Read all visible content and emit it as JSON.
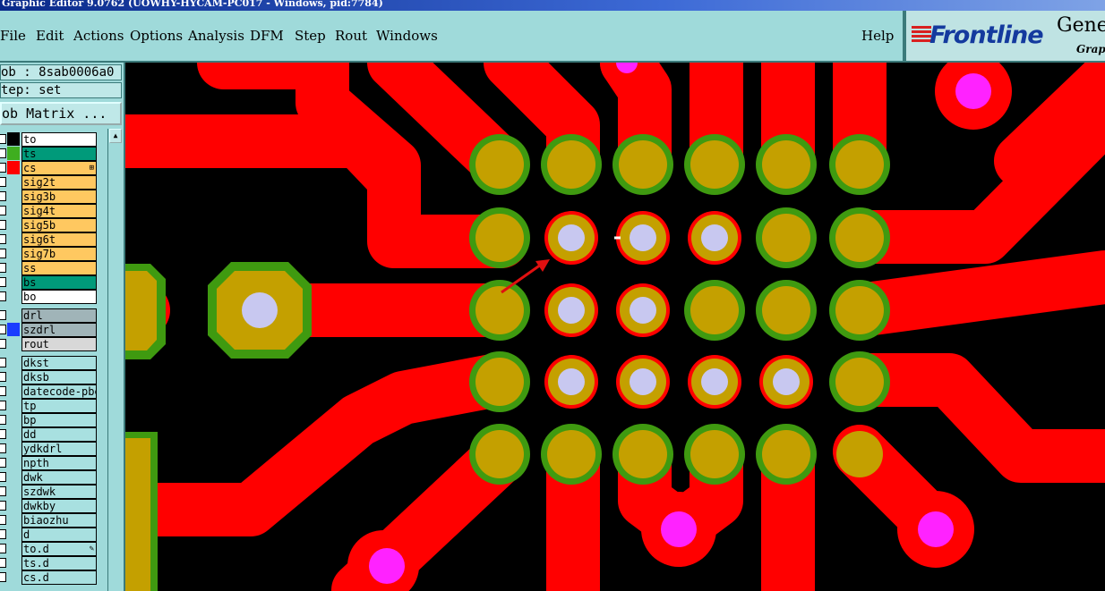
{
  "window": {
    "title": "Graphic Editor 9.0762 (UOWHY-HYCAM-PC017 - Windows, pid:7784)"
  },
  "menu": {
    "items": [
      {
        "label": "File",
        "underline": "F"
      },
      {
        "label": "Edit",
        "underline": "E"
      },
      {
        "label": "Actions",
        "underline": "A"
      },
      {
        "label": "Options",
        "underline": "O"
      },
      {
        "label": "Analysis",
        "underline": "y"
      },
      {
        "label": "DFM",
        "underline": "D"
      },
      {
        "label": "Step",
        "underline": "S"
      },
      {
        "label": "Rout",
        "underline": "R"
      },
      {
        "label": "Windows",
        "underline": "W"
      }
    ],
    "help": "Help"
  },
  "brand": {
    "logo": "Frontline",
    "line1": "Gene",
    "line2": "Graph"
  },
  "job": {
    "job_label": "ob : 8sab0006a0",
    "step_label": "tep: set",
    "matrix_button": "ob Matrix ..."
  },
  "layers": [
    {
      "name": "to",
      "bg": "#ffffff",
      "swatch": "#000000"
    },
    {
      "name": "ts",
      "bg": "#009a7a",
      "swatch": "#3fae1f"
    },
    {
      "name": "cs",
      "bg": "#ffc860",
      "swatch": "#ff0000",
      "mark": "⊞"
    },
    {
      "name": "sig2t",
      "bg": "#ffc860",
      "swatch": ""
    },
    {
      "name": "sig3b",
      "bg": "#ffc860",
      "swatch": ""
    },
    {
      "name": "sig4t",
      "bg": "#ffc860",
      "swatch": ""
    },
    {
      "name": "sig5b",
      "bg": "#ffc860",
      "swatch": ""
    },
    {
      "name": "sig6t",
      "bg": "#ffc860",
      "swatch": ""
    },
    {
      "name": "sig7b",
      "bg": "#ffc860",
      "swatch": ""
    },
    {
      "name": "ss",
      "bg": "#ffc860",
      "swatch": ""
    },
    {
      "name": "bs",
      "bg": "#009a7a",
      "swatch": ""
    },
    {
      "name": "bo",
      "bg": "#ffffff",
      "swatch": ""
    },
    {
      "name": "drl",
      "bg": "#a0b4b8",
      "swatch": ""
    },
    {
      "name": "szdrl",
      "bg": "#a0b4b8",
      "swatch": "#1a3cff"
    },
    {
      "name": "rout",
      "bg": "#d8d8d8",
      "swatch": ""
    },
    {
      "name": "dkst",
      "bg": "#a8e0e0",
      "swatch": ""
    },
    {
      "name": "dksb",
      "bg": "#a8e0e0",
      "swatch": ""
    },
    {
      "name": "datecode-pbe",
      "bg": "#a8e0e0",
      "swatch": ""
    },
    {
      "name": "tp",
      "bg": "#a8e0e0",
      "swatch": ""
    },
    {
      "name": "bp",
      "bg": "#a8e0e0",
      "swatch": ""
    },
    {
      "name": "dd",
      "bg": "#a8e0e0",
      "swatch": ""
    },
    {
      "name": "ydkdrl",
      "bg": "#a8e0e0",
      "swatch": ""
    },
    {
      "name": "npth",
      "bg": "#a8e0e0",
      "swatch": ""
    },
    {
      "name": "dwk",
      "bg": "#a8e0e0",
      "swatch": ""
    },
    {
      "name": "szdwk",
      "bg": "#a8e0e0",
      "swatch": ""
    },
    {
      "name": "dwkby",
      "bg": "#a8e0e0",
      "swatch": ""
    },
    {
      "name": "biaozhu",
      "bg": "#a8e0e0",
      "swatch": ""
    },
    {
      "name": "d",
      "bg": "#a8e0e0",
      "swatch": ""
    },
    {
      "name": "to.d",
      "bg": "#a8e0e0",
      "swatch": "",
      "mark": "✎"
    },
    {
      "name": "ts.d",
      "bg": "#a8e0e0",
      "swatch": ""
    },
    {
      "name": "cs.d",
      "bg": "#a8e0e0",
      "swatch": ""
    }
  ],
  "colors": {
    "trace": "#ff0000",
    "pad": "#c4a000",
    "mask": "#3f9a10",
    "drill": "#c8c8f0",
    "via": "#ff22ff",
    "arrow": "#e01010"
  }
}
